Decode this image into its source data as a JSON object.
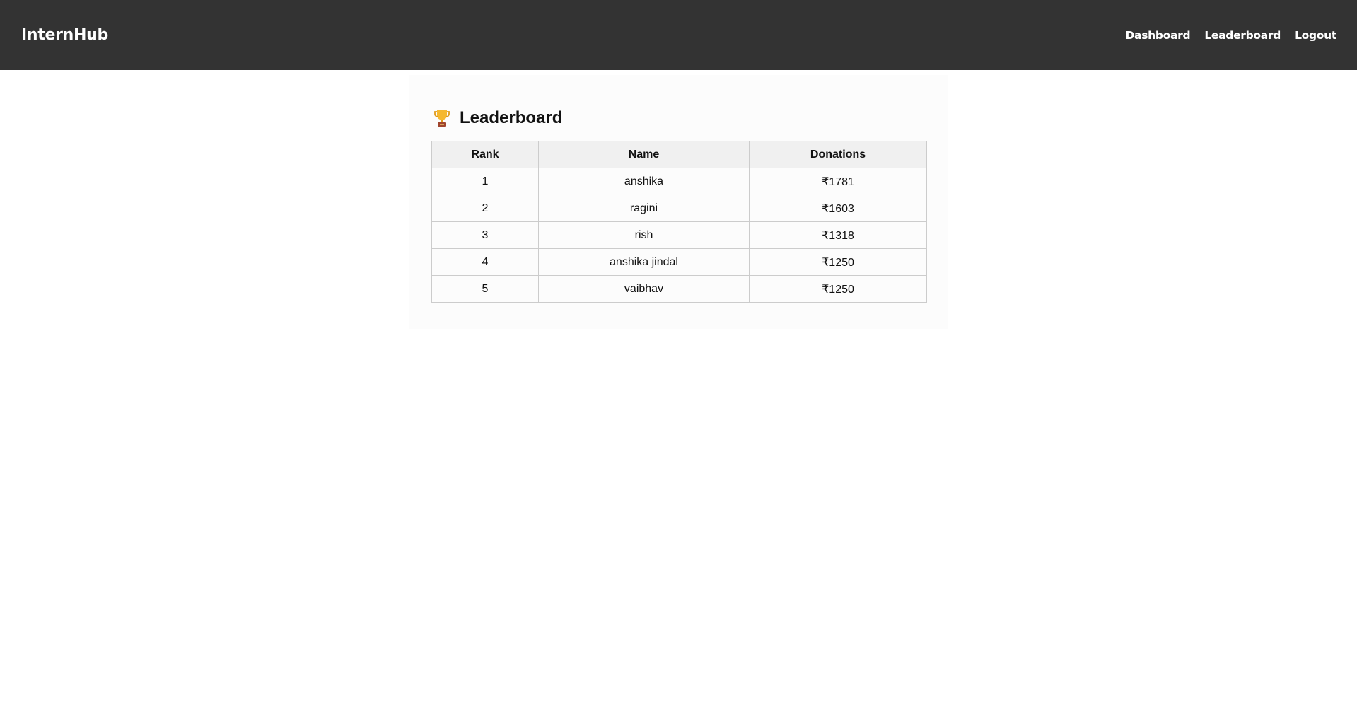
{
  "navbar": {
    "brand": "InternHub",
    "links": [
      "Dashboard",
      "Leaderboard",
      "Logout"
    ]
  },
  "leaderboard": {
    "icon": "trophy-icon",
    "title": "Leaderboard",
    "columns": [
      "Rank",
      "Name",
      "Donations"
    ],
    "rows": [
      {
        "rank": "1",
        "name": "anshika",
        "donations": "₹1781"
      },
      {
        "rank": "2",
        "name": "ragini",
        "donations": "₹1603"
      },
      {
        "rank": "3",
        "name": "rish",
        "donations": "₹1318"
      },
      {
        "rank": "4",
        "name": "anshika jindal",
        "donations": "₹1250"
      },
      {
        "rank": "5",
        "name": "vaibhav",
        "donations": "₹1250"
      }
    ]
  },
  "colors": {
    "navbar_bg": "#333333",
    "card_bg": "#fcfcfc",
    "header_bg": "#f0f0f0",
    "border": "#cccccc"
  }
}
